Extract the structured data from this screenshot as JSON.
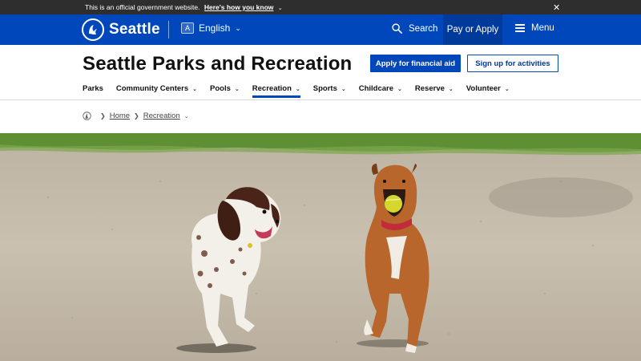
{
  "gov_banner": {
    "text": "This is an official government website.",
    "link": "Here's how you know",
    "close_icon": "close-icon"
  },
  "topnav": {
    "brand": "Seattle",
    "language": "English",
    "search": "Search",
    "pay": "Pay or Apply",
    "menu": "Menu"
  },
  "header": {
    "title": "Seattle Parks and Recreation",
    "financial_aid": "Apply for financial aid",
    "signup": "Sign up for activities"
  },
  "secnav": {
    "items": [
      {
        "label": "Parks"
      },
      {
        "label": "Community Centers"
      },
      {
        "label": "Pools"
      },
      {
        "label": "Recreation"
      },
      {
        "label": "Sports"
      },
      {
        "label": "Childcare"
      },
      {
        "label": "Reserve"
      },
      {
        "label": "Volunteer"
      }
    ],
    "active": "Recreation"
  },
  "breadcrumb": {
    "home": "Home",
    "current": "Recreation"
  },
  "hero": {
    "icon": "photo-dogs-running"
  },
  "colors": {
    "brand_blue": "#0047bb",
    "banner_dark": "#2e2e2e",
    "pay_bg": "#003a9b"
  }
}
